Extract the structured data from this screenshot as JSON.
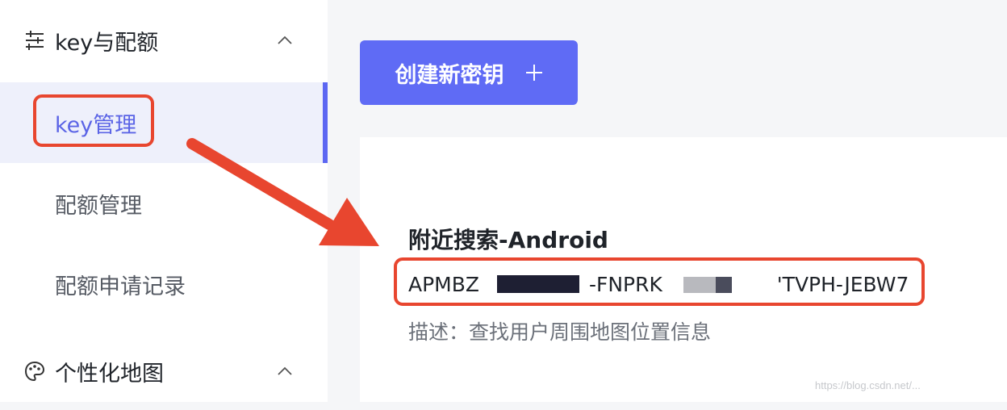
{
  "sidebar": {
    "group1": {
      "label": "key与配额",
      "icon": "sliders-icon"
    },
    "items": [
      {
        "label": "key管理",
        "active": true
      },
      {
        "label": "配额管理",
        "active": false
      },
      {
        "label": "配额申请记录",
        "active": false
      }
    ],
    "group2": {
      "label": "个性化地图",
      "icon": "palette-icon"
    }
  },
  "main": {
    "create_button": {
      "label": "创建新密钥",
      "icon": "plus-icon"
    },
    "key_card": {
      "title": "附近搜索-Android",
      "key_parts": [
        "APMBZ",
        "-FNPRK",
        "'TVPH-JEBW7"
      ],
      "description": "描述：查找用户周围地图位置信息"
    }
  },
  "colors": {
    "accent": "#5f6bf5",
    "annotation_red": "#e8462f",
    "sidebar_active_bg": "#eef0fb"
  },
  "watermark": "https://blog.csdn.net/..."
}
